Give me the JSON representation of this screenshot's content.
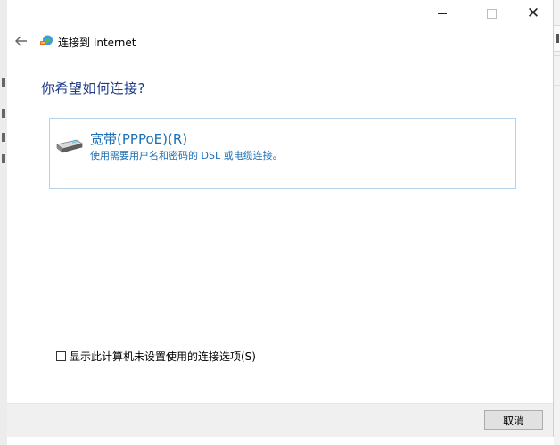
{
  "window": {
    "title": "连接到 Internet",
    "minimize_icon": "minimize-icon",
    "maximize_icon": "maximize-icon",
    "close_icon": "close-icon",
    "close_glyph": "✕"
  },
  "header": {
    "back_icon": "back-arrow-icon",
    "app_icon": "network-globe-icon"
  },
  "main": {
    "question": "你希望如何连接?",
    "options": [
      {
        "icon": "broadband-modem-icon",
        "title": "宽带(PPPoE)(R)",
        "description": "使用需要用户名和密码的 DSL 或电缆连接。"
      }
    ],
    "show_all_checkbox": {
      "checked": false,
      "label": "显示此计算机未设置使用的连接选项(S)"
    }
  },
  "footer": {
    "cancel_label": "取消"
  },
  "colors": {
    "question": "#1e3a8a",
    "option_text": "#1c6fb6",
    "option_border": "#b4d3ea",
    "footer_bg": "#f0f0f0"
  }
}
